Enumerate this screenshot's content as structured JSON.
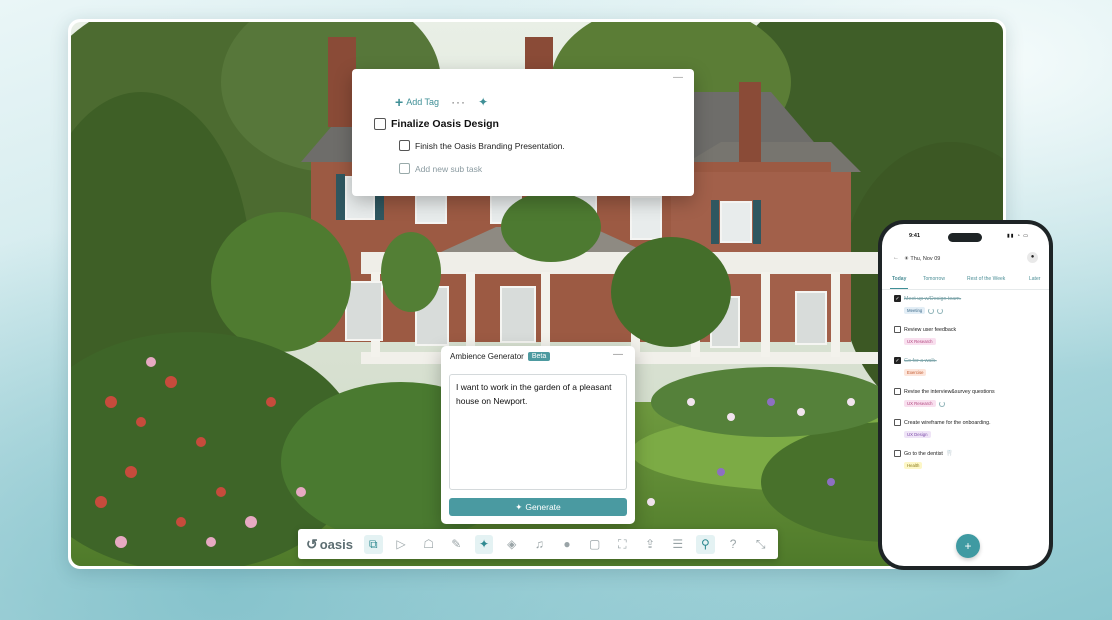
{
  "colors": {
    "accent": "#4a9aa1",
    "page_bg": "#cfe9ec"
  },
  "task_card": {
    "add_tag_label": "Add Tag",
    "more_icon": "more-dots-icon",
    "magic_icon": "sparkle-icon",
    "main_task": "Finalize Oasis Design",
    "subtasks": [
      {
        "label": "Finish the Oasis Branding Presentation.",
        "checked": false
      },
      {
        "label": "Add new sub task",
        "placeholder": true
      }
    ]
  },
  "ambience": {
    "title": "Ambience Generator",
    "badge": "Beta",
    "prompt_text": "I want to work in the garden of a pleasant house on Newport.",
    "generate_label": "Generate"
  },
  "dock": {
    "logo_text": "oasis",
    "icons": [
      "layers-copy-icon",
      "play-icon",
      "robot-icon",
      "pen-icon",
      "sparkle-icon",
      "stack-icon",
      "music-note-icon",
      "spotify-icon",
      "chat-bubble-icon",
      "fullscreen-icon",
      "share-icon",
      "notes-icon",
      "pin-icon",
      "help-icon",
      "collapse-icon"
    ],
    "active_icons": [
      "layers-copy-icon",
      "sparkle-icon",
      "pin-icon"
    ]
  },
  "phone": {
    "time": "9:41",
    "date": "Thu, Nov 09",
    "tabs": [
      "Today",
      "Tomorrow",
      "Rest of the Week",
      "Later"
    ],
    "active_tab": "Today",
    "tasks": [
      {
        "title": "Meet up w/Design team.",
        "done": true,
        "tag": "Meeting"
      },
      {
        "title": "Review user feedback",
        "done": false,
        "tag": "UX Research"
      },
      {
        "title": "Go for a walk.",
        "done": true,
        "tag": "Exercise"
      },
      {
        "title": "Revise the interview&survey questions",
        "done": false,
        "tag": "UX Research"
      },
      {
        "title": "Create wireframe for the onboarding.",
        "done": false,
        "tag": "UX Design"
      },
      {
        "title": "Go to the dentist",
        "done": false,
        "tag": "Health"
      }
    ],
    "fab_label": "+"
  }
}
